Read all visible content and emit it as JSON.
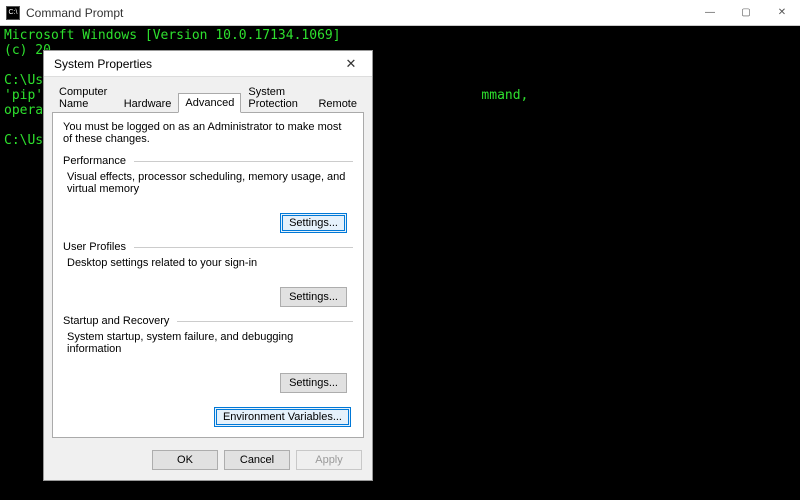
{
  "cmd": {
    "title": "Command Prompt",
    "lines": [
      "Microsoft Windows [Version 10.0.17134.1069]",
      "(c) 20",
      "",
      "C:\\Use",
      "'pip'                                                        mmand,",
      "operab",
      "",
      "C:\\Use"
    ]
  },
  "winctrls": {
    "min": "—",
    "max": "▢",
    "close": "✕"
  },
  "dialog": {
    "title": "System Properties",
    "close": "✕",
    "tabs": {
      "computer_name": "Computer Name",
      "hardware": "Hardware",
      "advanced": "Advanced",
      "system_protection": "System Protection",
      "remote": "Remote"
    },
    "admin_note": "You must be logged on as an Administrator to make most of these changes.",
    "performance": {
      "title": "Performance",
      "desc": "Visual effects, processor scheduling, memory usage, and virtual memory",
      "settings": "Settings..."
    },
    "user_profiles": {
      "title": "User Profiles",
      "desc": "Desktop settings related to your sign-in",
      "settings": "Settings..."
    },
    "startup": {
      "title": "Startup and Recovery",
      "desc": "System startup, system failure, and debugging information",
      "settings": "Settings..."
    },
    "env_vars": "Environment Variables...",
    "buttons": {
      "ok": "OK",
      "cancel": "Cancel",
      "apply": "Apply"
    }
  }
}
